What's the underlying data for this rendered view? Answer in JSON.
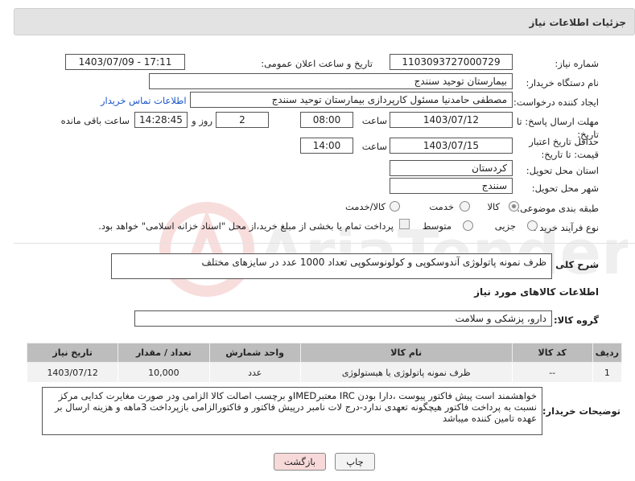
{
  "header": {
    "title": "جزئیات اطلاعات نیاز"
  },
  "fields": {
    "need_number_label": "شماره نیاز:",
    "need_number": "1103093727000729",
    "announce_label": "تاریخ و ساعت اعلان عمومی:",
    "announce_value": "1403/07/09 - 17:11",
    "buyer_org_label": "نام دستگاه خریدار:",
    "buyer_org": "بیمارستان توحید سنندج",
    "creator_label": "ایجاد کننده درخواست:",
    "creator": "مصطفی حامدنیا مسئول کارپردازی بیمارستان توحید سنندج",
    "contact_link": "اطلاعات تماس خریدار",
    "deadline_label": "مهلت ارسال پاسخ: تا تاریخ:",
    "deadline_date": "1403/07/12",
    "time_label": "ساعت",
    "deadline_time": "08:00",
    "days_value": "2",
    "days_label": "روز و",
    "remaining_time": "14:28:45",
    "remaining_label": "ساعت باقی مانده",
    "validity_label": "حداقل تاریخ اعتبار قیمت: تا تاریخ:",
    "validity_date": "1403/07/15",
    "validity_time": "14:00",
    "province_label": "استان محل تحویل:",
    "province": "کردستان",
    "city_label": "شهر محل تحویل:",
    "city": "سنندج",
    "category_label": "طبقه بندی موضوعی:",
    "category_options": [
      "کالا",
      "خدمت",
      "کالا/خدمت"
    ],
    "purchase_label": "نوع فرآیند خرید :",
    "purchase_options": [
      "جزیی",
      "متوسط"
    ],
    "purchase_note": "پرداخت تمام یا بخشی از مبلغ خرید،از محل \"اسناد خزانه اسلامی\" خواهد بود.",
    "summary_label": "شرح کلی نیاز:",
    "summary": "ظرف نمونه پاتولوژی آندوسکوپی و کولونوسکوپی تعداد 1000 عدد در سایزهای مختلف",
    "goods_info_title": "اطلاعات کالاهای مورد نیاز",
    "goods_group_label": "گروه کالا:",
    "goods_group": "دارو، پزشکی و سلامت"
  },
  "table": {
    "headers": [
      "ردیف",
      "کد کالا",
      "نام کالا",
      "واحد شمارش",
      "تعداد / مقدار",
      "تاریخ نیاز"
    ],
    "rows": [
      {
        "row": "1",
        "code": "--",
        "name": "ظرف نمونه پاتولوژی یا هیستولوژی",
        "unit": "عدد",
        "qty": "10,000",
        "date": "1403/07/12"
      }
    ]
  },
  "buyer_notes_label": "توضیحات خریدار:",
  "buyer_notes": "خواهشمند است پیش فاکتور پیوست ،دارا بودن IRC معتبرIMEDو برچسب اصالت کالا الزامی ودر صورت مغایرت کدایی مرکز نسبت به پرداخت فاکتور هیچگونه تعهدی ندارد-درج لات نامبر درپیش فاکتور و فاکتورالزامی  بازپرداخت 3ماهه و هزینه ارسال بر عهده تامین کننده میباشد",
  "buttons": {
    "print": "چاپ",
    "back": "بازگشت"
  },
  "watermark": "AriaTender.net",
  "colors": {
    "header_bg": "#e3e3e3",
    "table_header": "#bdbdbd",
    "back_button": "#f7d9d9",
    "link": "#1a56c7"
  }
}
